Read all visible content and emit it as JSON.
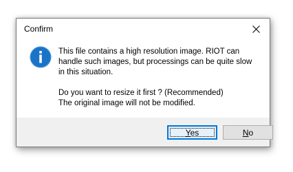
{
  "dialog": {
    "title": "Confirm",
    "icon": "info-icon",
    "message_lines_1": [
      "This file contains a high resolution image. RIOT can",
      "handle such images, but processings can be quite slow",
      "in this situation."
    ],
    "message_lines_2": [
      "Do you want to resize it first ? (Recommended)",
      "The original image will not be modified."
    ],
    "buttons": {
      "yes": {
        "mnemonic": "Y",
        "rest": "es"
      },
      "no": {
        "mnemonic": "N",
        "rest": "o"
      }
    },
    "accent_color": "#0078d7",
    "icon_color": "#1a73c6"
  }
}
